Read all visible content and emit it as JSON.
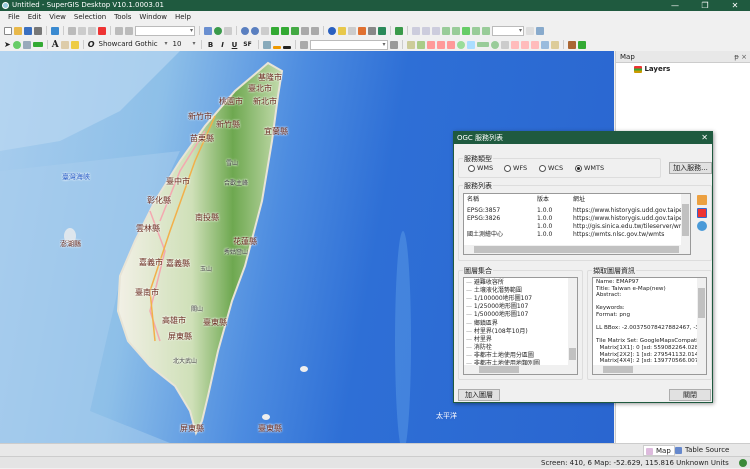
{
  "window": {
    "title": "Untitled - SuperGIS Desktop V10.1.0003.01",
    "minimize": "—",
    "maximize": "❐",
    "close": "✕"
  },
  "menu": [
    "File",
    "Edit",
    "View",
    "Selection",
    "Tools",
    "Window",
    "Help"
  ],
  "toolbar": {
    "font_family": "Showcard Gothic",
    "font_size": "10",
    "bold": "B",
    "italic": "I",
    "underline": "U",
    "strike": "SF",
    "text_tool": "A"
  },
  "map": {
    "labels": [
      "基隆市",
      "臺北市",
      "桃園市",
      "新北市",
      "新竹市",
      "新竹縣",
      "宜蘭縣",
      "苗栗縣",
      "臺中市",
      "彰化縣",
      "南投縣",
      "雲林縣",
      "花蓮縣",
      "嘉義市",
      "嘉義縣",
      "臺南市",
      "高雄市",
      "臺東縣",
      "屏東縣",
      "屏東縣",
      "臺東縣"
    ],
    "peaks": [
      "雪山",
      "合歡主峰",
      "秀姑巒山",
      "玉山",
      "關山",
      "北大武山"
    ],
    "sea_labels": [
      "臺灣海峽",
      "澎湖縣",
      "太平洋"
    ]
  },
  "layers_panel": {
    "title": "Map",
    "pin": "ᵽ",
    "close": "×",
    "root": "Layers"
  },
  "tabs": [
    {
      "label": "Map",
      "active": true
    },
    {
      "label": "Table Source",
      "active": false
    }
  ],
  "status": {
    "text": "Screen: 410, 6  Map: -52.629, 115.816 Unknown Units"
  },
  "dialog": {
    "title": "OGC 服務列表",
    "close": "✕",
    "service_type_label": "服務類型",
    "service_types": [
      {
        "label": "WMS",
        "selected": false
      },
      {
        "label": "WFS",
        "selected": false
      },
      {
        "label": "WCS",
        "selected": false
      },
      {
        "label": "WMTS",
        "selected": true
      }
    ],
    "add_service": "加入服務...",
    "service_list_label": "服務列表",
    "columns": [
      "名稱",
      "版本",
      "網址"
    ],
    "services": [
      {
        "name": "EPSG:3857",
        "version": "1.0.0",
        "url": "https://www.historygis.udd.gov.taipei/WMT"
      },
      {
        "name": "EPSG:3826",
        "version": "1.0.0",
        "url": "https://www.historygis.udd.gov.taipei/WMT"
      },
      {
        "name": "",
        "version": "1.0.0",
        "url": "http://gis.sinica.edu.tw/tileserver/wmts"
      },
      {
        "name": "國土測繪中心",
        "version": "1.0.0",
        "url": "https://wmts.nlsc.gov.tw/wmts"
      }
    ],
    "layer_set_label": "圖層集合",
    "layers": [
      "避難收容所",
      "土壤液化潛勢範圍",
      "1/100000地形圖107",
      "1/25000地形圖107",
      "1/50000地形圖107",
      "鄉鎮區界",
      "村里界(108年10月)",
      "村里界",
      "消防栓",
      "非都市土地使用分區圖",
      "非都市土地使用地類別圖"
    ],
    "layer_info_label": "擷取圖層資訊",
    "layer_info": [
      "Name: EMAP97",
      "Title: Taiwan e-Map(new)",
      "Abstract:",
      "",
      "Keywords:",
      "Format: png",
      "",
      "LL BBox: -2.00375078427882467, -3.0",
      "",
      "Tile Matrix Set: GoogleMapsCompatible",
      "  Matrix[1X1]: 0 [sd: 559082264.02871",
      "  Matrix[2X2]: 1 [sd: 279541132.01435",
      "  Matrix[4X4]: 2 [sd: 139770566.00717",
      "  Matrix[8X8]: 3 [sd: 69885283.003589"
    ],
    "add_layer": "加入圖層",
    "close_button": "關閉"
  },
  "colors": {
    "title_bar": "#1f5a3f",
    "sea": "#2e6fd6",
    "land": "#f5f3ea",
    "mountain": "#6ea850"
  }
}
